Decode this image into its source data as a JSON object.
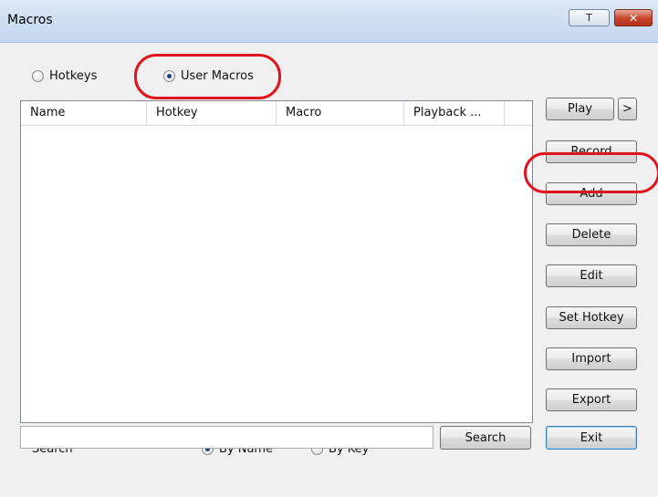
{
  "window": {
    "title": "Macros",
    "controls": {
      "restore_label": "T",
      "close_label": "x"
    }
  },
  "mode": {
    "hotkeys_label": "Hotkeys",
    "user_macros_label": "User Macros",
    "selected": "User Macros"
  },
  "table": {
    "columns": [
      "Name",
      "Hotkey",
      "Macro",
      "Playback ..."
    ],
    "rows": []
  },
  "buttons": {
    "play": "Play",
    "play_more": ">",
    "record": "Record",
    "add": "Add",
    "delete": "Delete",
    "edit": "Edit",
    "set_hotkey": "Set Hotkey",
    "import": "Import",
    "export": "Export",
    "search": "Search",
    "exit": "Exit"
  },
  "search": {
    "label": "Search",
    "by_name_label": "By Name",
    "by_key_label": "By Key",
    "selected": "By Name",
    "value": ""
  },
  "colors": {
    "highlight": "#e0141e",
    "titlebar": "#c4d6ee",
    "close_button": "#c6432b"
  }
}
